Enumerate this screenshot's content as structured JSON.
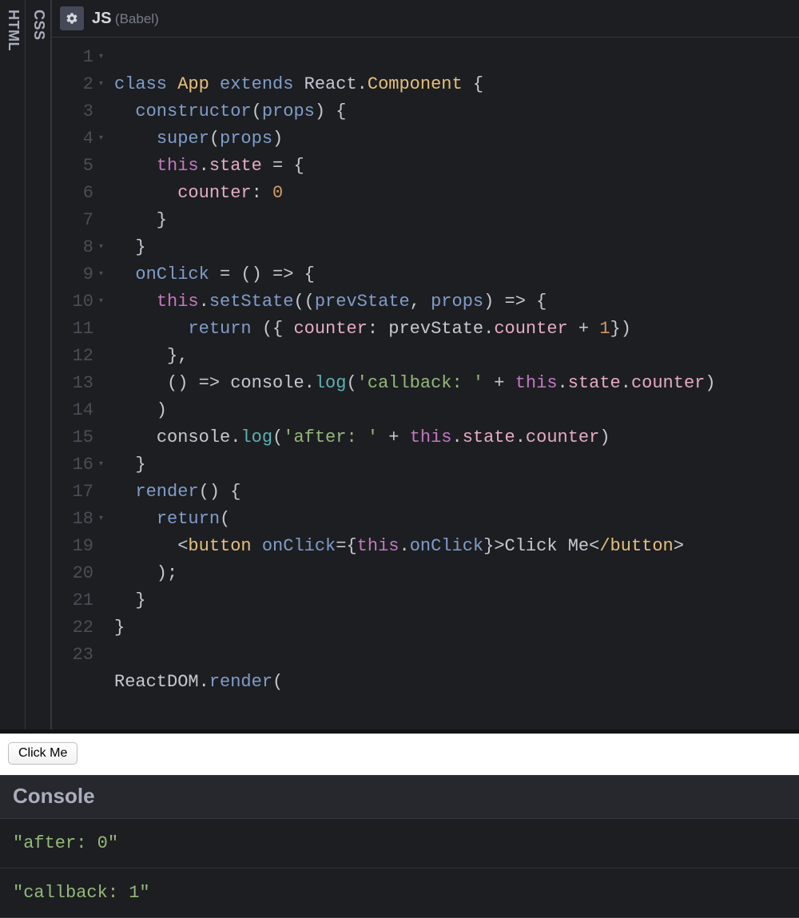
{
  "tabs": {
    "html": "HTML",
    "css": "CSS"
  },
  "header": {
    "title": "JS",
    "subtitle": "(Babel)"
  },
  "gutter": {
    "numbers": [
      "1",
      "2",
      "3",
      "4",
      "5",
      "6",
      "7",
      "8",
      "9",
      "10",
      "11",
      "12",
      "13",
      "14",
      "15",
      "16",
      "17",
      "18",
      "19",
      "20",
      "21",
      "22",
      "23"
    ],
    "folds": [
      true,
      true,
      false,
      true,
      false,
      false,
      false,
      true,
      true,
      true,
      false,
      false,
      false,
      false,
      false,
      true,
      false,
      true,
      false,
      false,
      false,
      false,
      false
    ]
  },
  "code": {
    "l1": {
      "a": "class ",
      "b": "App ",
      "c": "extends ",
      "d": "React",
      "e": ".",
      "f": "Component ",
      "g": "{"
    },
    "l2": {
      "a": "  ",
      "b": "constructor",
      "c": "(",
      "d": "props",
      "e": ") {"
    },
    "l3": {
      "a": "    ",
      "b": "super",
      "c": "(",
      "d": "props",
      "e": ")"
    },
    "l4": {
      "a": "    ",
      "b": "this",
      "c": ".",
      "d": "state",
      "e": " = {"
    },
    "l5": {
      "a": "      ",
      "b": "counter",
      "c": ": ",
      "d": "0"
    },
    "l6": {
      "a": "    }"
    },
    "l7": {
      "a": "  }"
    },
    "l8": {
      "a": "  ",
      "b": "onClick",
      "c": " = () => {"
    },
    "l9": {
      "a": "    ",
      "b": "this",
      "c": ".",
      "d": "setState",
      "e": "((",
      "f": "prevState",
      "g": ", ",
      "h": "props",
      "i": ") => {"
    },
    "l10": {
      "a": "       ",
      "b": "return ",
      "c": "({ ",
      "d": "counter",
      "e": ": ",
      "f": "prevState",
      "g": ".",
      "h": "counter",
      "i": " + ",
      "j": "1",
      "k": "})"
    },
    "l11": {
      "a": "     },"
    },
    "l12": {
      "a": "     () => ",
      "b": "console",
      "c": ".",
      "d": "log",
      "e": "(",
      "f": "'callback: '",
      "g": " + ",
      "h": "this",
      "i": ".",
      "j": "state",
      "k": ".",
      "l": "counter",
      "m": ")"
    },
    "l13": {
      "a": "    )"
    },
    "l14": {
      "a": "    ",
      "b": "console",
      "c": ".",
      "d": "log",
      "e": "(",
      "f": "'after: '",
      "g": " + ",
      "h": "this",
      "i": ".",
      "j": "state",
      "k": ".",
      "l": "counter",
      "m": ")"
    },
    "l15": {
      "a": "  }"
    },
    "l16": {
      "a": "  ",
      "b": "render",
      "c": "() {"
    },
    "l17": {
      "a": "    ",
      "b": "return",
      "c": "("
    },
    "l18": {
      "a": "      ",
      "b": "<",
      "c": "button ",
      "d": "onClick",
      "e": "=",
      "f": "{",
      "g": "this",
      "h": ".",
      "i": "onClick",
      "j": "}",
      "k": ">",
      "l": "Click Me",
      "m": "<",
      "n": "/button",
      "o": ">"
    },
    "l19": {
      "a": "    );"
    },
    "l20": {
      "a": "  }"
    },
    "l21": {
      "a": "}"
    },
    "l22": {
      "a": ""
    },
    "l23": {
      "a": "ReactDOM",
      "b": ".",
      "c": "render",
      "d": "("
    }
  },
  "preview": {
    "button_label": "Click Me"
  },
  "console": {
    "title": "Console",
    "rows": [
      "\"after: 0\"",
      "\"callback: 1\""
    ]
  }
}
